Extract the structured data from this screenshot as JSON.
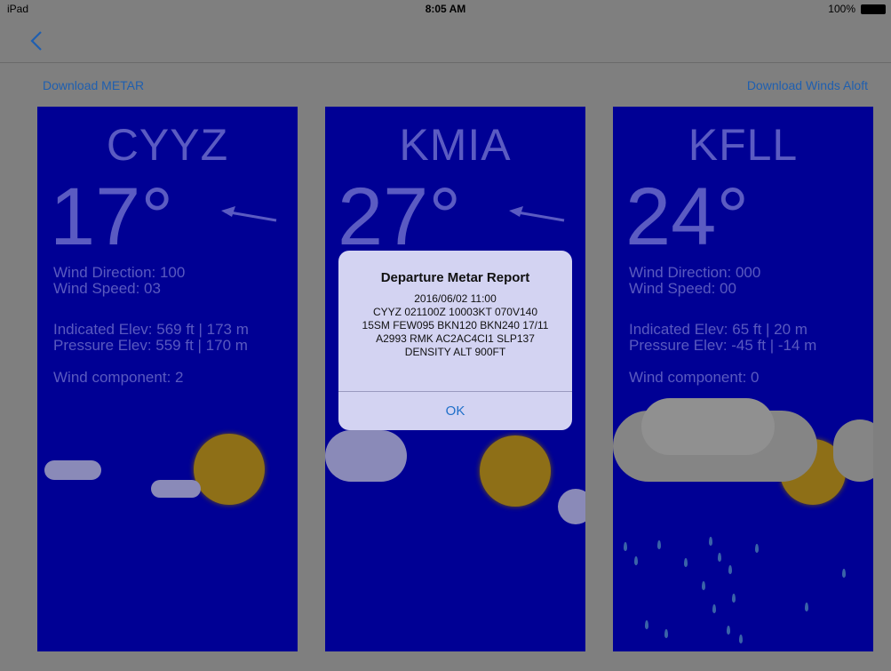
{
  "status_bar": {
    "device": "iPad",
    "time": "8:05 AM",
    "battery": "100%"
  },
  "nav": {
    "back_icon": "chevron-left-icon"
  },
  "actions": {
    "download_metar": "Download METAR",
    "download_winds_aloft": "Download Winds Aloft"
  },
  "stations": [
    {
      "code": "CYYZ",
      "temp": "17°",
      "wind_direction": "Wind Direction: 100",
      "wind_speed": "Wind Speed: 03",
      "indicated_elev": "Indicated Elev: 569 ft | 173 m",
      "pressure_elev": "Pressure Elev: 559 ft | 170 m",
      "wind_component": "Wind component: 2"
    },
    {
      "code": "KMIA",
      "temp": "27°"
    },
    {
      "code": "KFLL",
      "temp": "24°",
      "wind_direction": "Wind Direction: 000",
      "wind_speed": "Wind Speed: 00",
      "indicated_elev": "Indicated Elev: 65 ft | 20 m",
      "pressure_elev": "Pressure Elev: -45 ft | -14 m",
      "wind_component": "Wind component: 0"
    }
  ],
  "alert": {
    "title": "Departure Metar Report",
    "line1": "2016/06/02 11:00",
    "line2": "CYYZ 021100Z 10003KT 070V140",
    "line3": "15SM FEW095 BKN120 BKN240 17/11",
    "line4": "A2993 RMK AC2AC4CI1 SLP137",
    "line5": "DENSITY ALT 900FT",
    "ok": "OK"
  },
  "colors": {
    "panel": "#000094",
    "dim_overlay": "#7f7f7f",
    "link": "#1f5fb0",
    "alert_bg": "#d3d3f2"
  }
}
